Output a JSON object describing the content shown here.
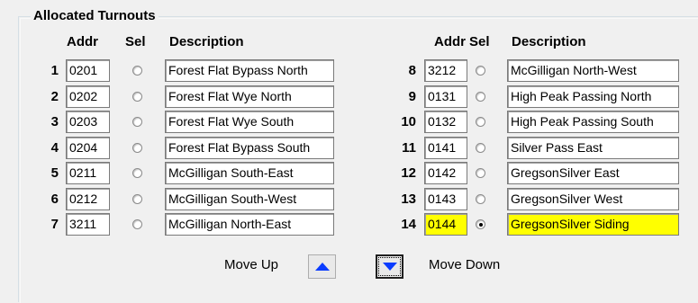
{
  "group": {
    "title": "Allocated Turnouts"
  },
  "headers": {
    "addr": "Addr",
    "sel": "Sel",
    "description": "Description"
  },
  "left_rows": [
    {
      "num": "1",
      "addr": "0201",
      "selected": false,
      "description": "Forest Flat Bypass North"
    },
    {
      "num": "2",
      "addr": "0202",
      "selected": false,
      "description": "Forest Flat Wye North"
    },
    {
      "num": "3",
      "addr": "0203",
      "selected": false,
      "description": "Forest Flat Wye South"
    },
    {
      "num": "4",
      "addr": "0204",
      "selected": false,
      "description": "Forest Flat Bypass South"
    },
    {
      "num": "5",
      "addr": "0211",
      "selected": false,
      "description": "McGilligan South-East"
    },
    {
      "num": "6",
      "addr": "0212",
      "selected": false,
      "description": "McGilligan South-West"
    },
    {
      "num": "7",
      "addr": "3211",
      "selected": false,
      "description": "McGilligan North-East"
    }
  ],
  "right_rows": [
    {
      "num": "8",
      "addr": "3212",
      "selected": false,
      "description": "McGilligan North-West"
    },
    {
      "num": "9",
      "addr": "0131",
      "selected": false,
      "description": "High Peak Passing North"
    },
    {
      "num": "10",
      "addr": "0132",
      "selected": false,
      "description": "High Peak Passing South"
    },
    {
      "num": "11",
      "addr": "0141",
      "selected": false,
      "description": "Silver Pass East"
    },
    {
      "num": "12",
      "addr": "0142",
      "selected": false,
      "description": "GregsonSilver East"
    },
    {
      "num": "13",
      "addr": "0143",
      "selected": false,
      "description": "GregsonSilver West"
    },
    {
      "num": "14",
      "addr": "0144",
      "selected": true,
      "description": "GregsonSilver Siding"
    }
  ],
  "controls": {
    "move_up_label": "Move Up",
    "move_up_icon": "arrow-up-icon",
    "move_down_label": "Move Down",
    "move_down_icon": "arrow-down-icon"
  },
  "colors": {
    "highlight": "#ffff00",
    "arrow": "#0a3cff"
  }
}
